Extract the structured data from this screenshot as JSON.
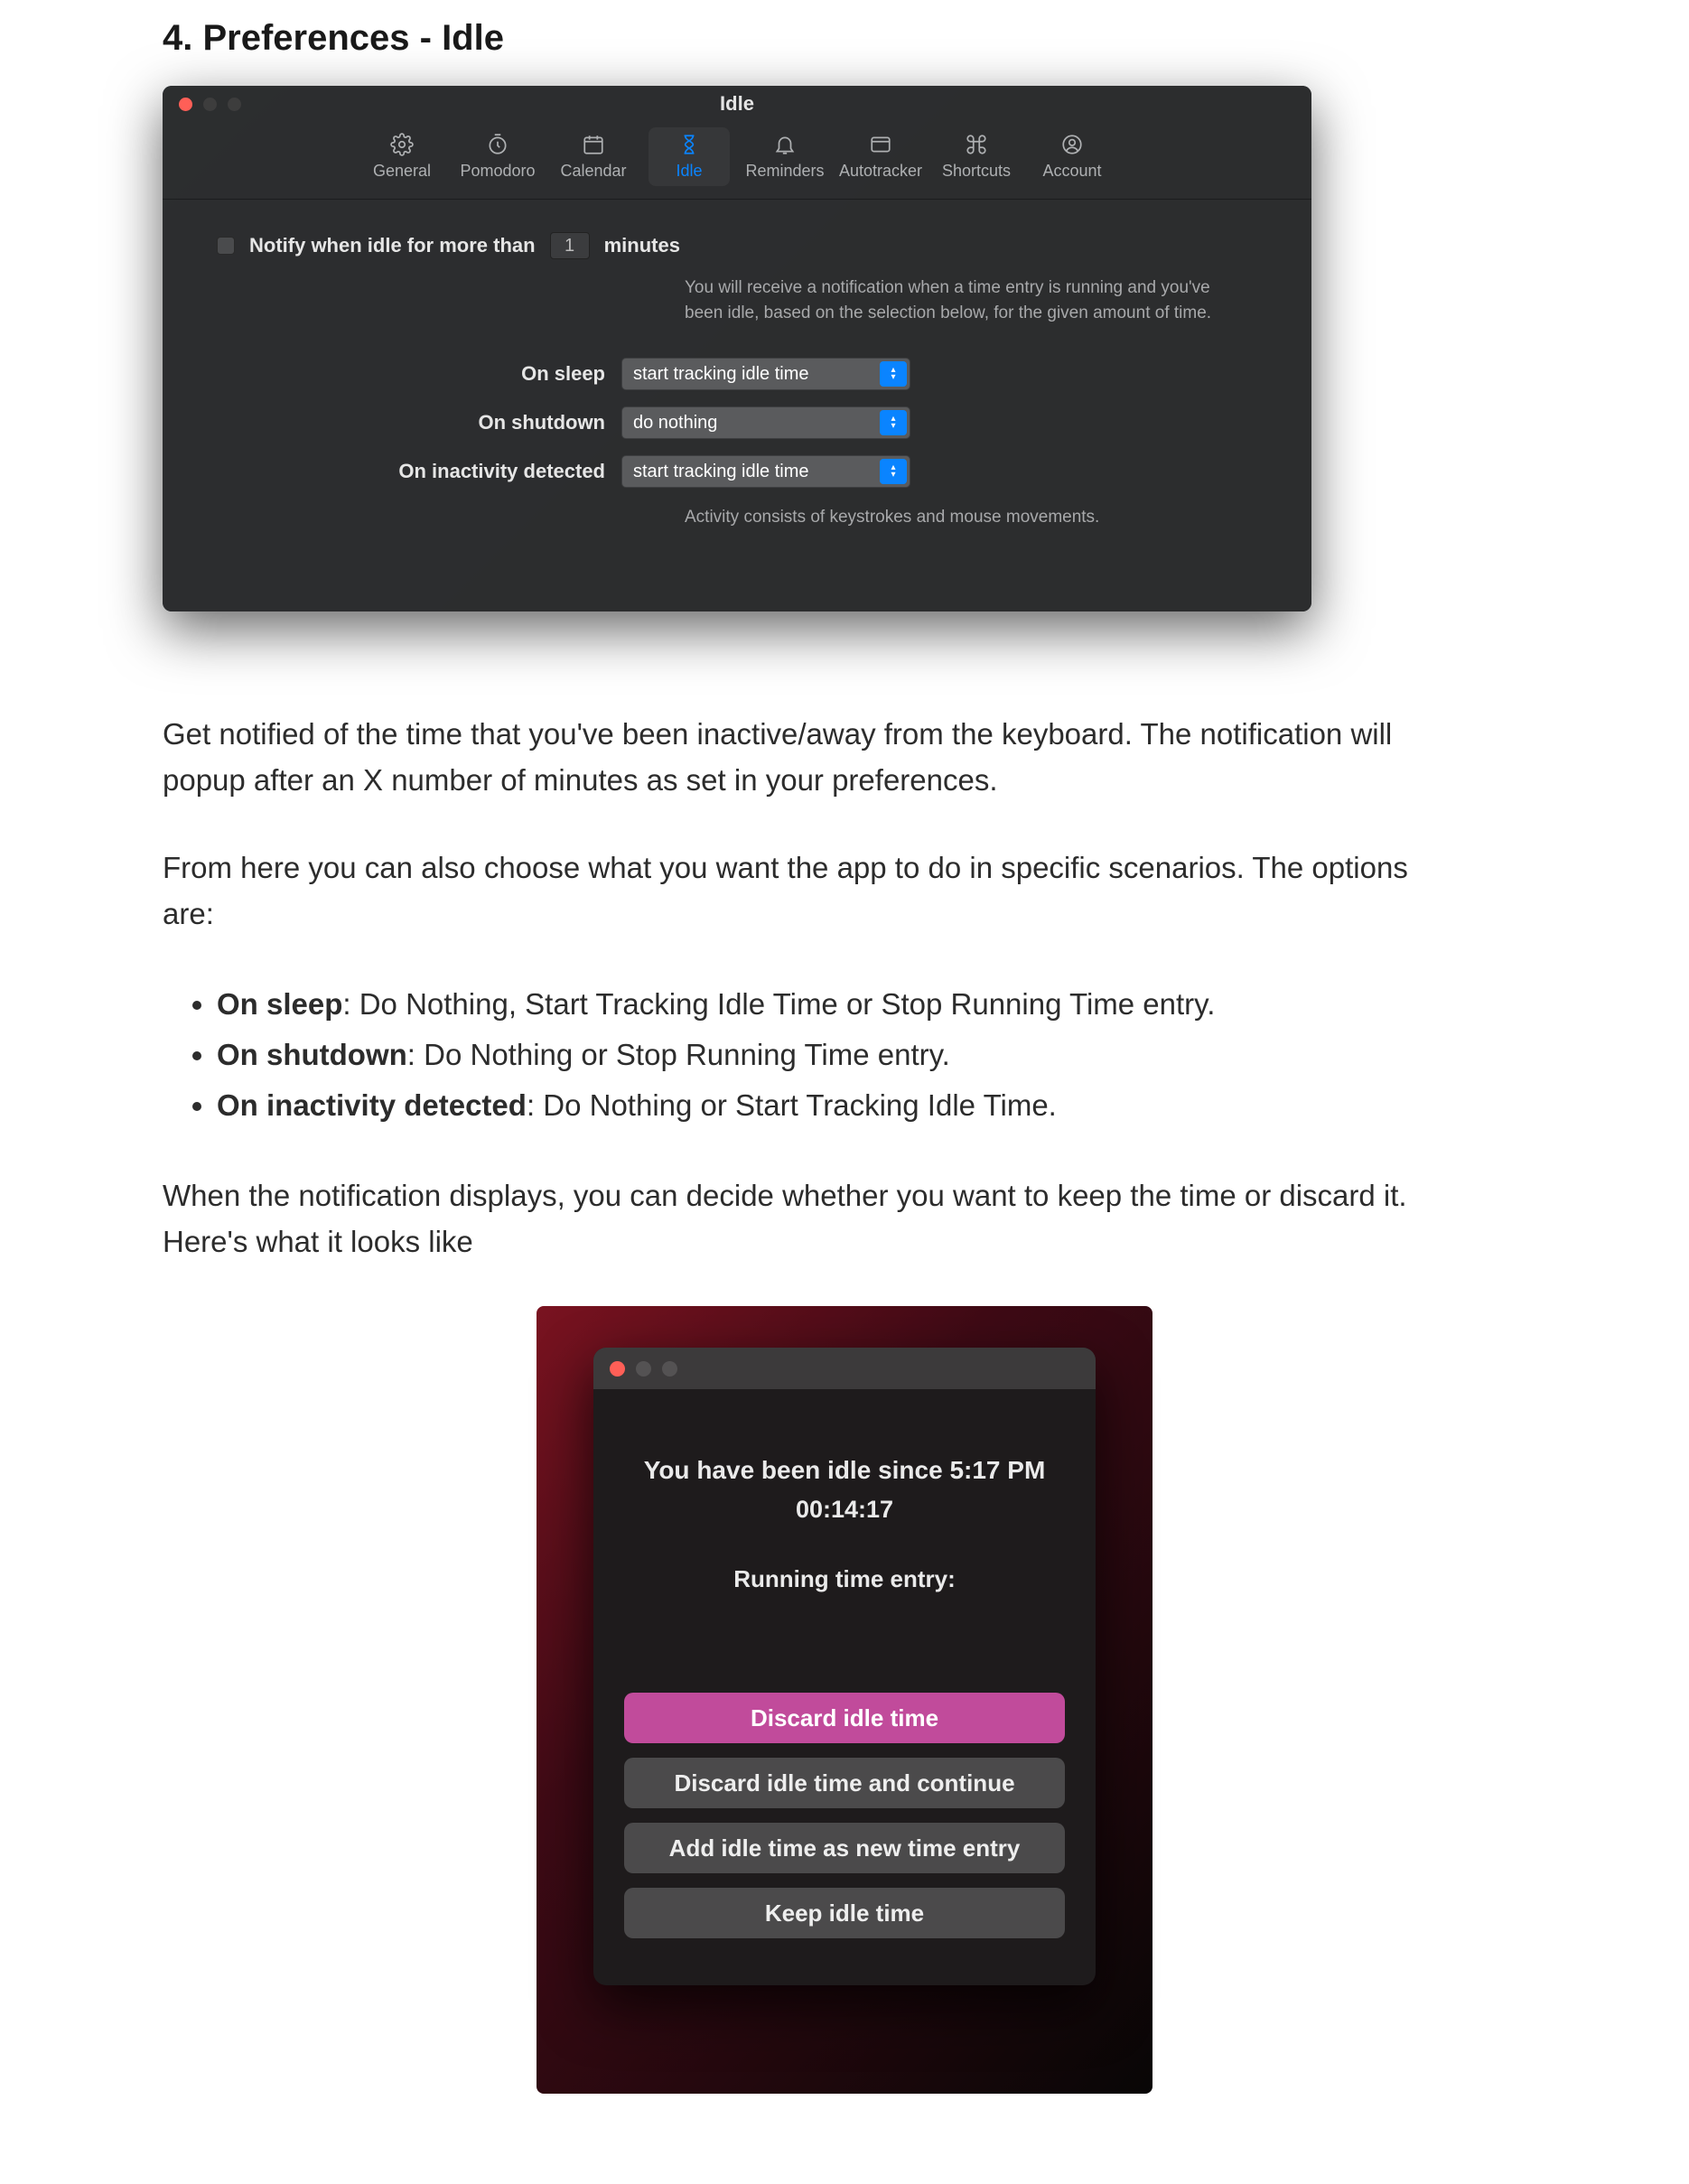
{
  "heading": "4. Preferences - Idle",
  "prefs": {
    "title": "Idle",
    "tabs": [
      {
        "label": "General"
      },
      {
        "label": "Pomodoro"
      },
      {
        "label": "Calendar"
      },
      {
        "label": "Idle"
      },
      {
        "label": "Reminders"
      },
      {
        "label": "Autotracker"
      },
      {
        "label": "Shortcuts"
      },
      {
        "label": "Account"
      }
    ],
    "notify_prefix": "Notify when idle for more than",
    "notify_value": "1",
    "notify_suffix": "minutes",
    "help": "You will receive a notification when a time entry is running and you've been idle, based on the selection below, for the given amount of time.",
    "rows": {
      "sleep_label": "On sleep",
      "sleep_value": "start tracking idle time",
      "shutdown_label": "On shutdown",
      "shutdown_value": "do nothing",
      "inactivity_label": "On inactivity detected",
      "inactivity_value": "start tracking idle time"
    },
    "activity_note": "Activity consists of keystrokes and mouse movements."
  },
  "para1": "Get notified of the time that you've been inactive/away from the keyboard. The notification will popup after an X number of minutes as set in your preferences.",
  "para2": "From here you can also choose what you want the app to do in specific scenarios. The options are:",
  "bullets": {
    "b1_strong": "On sleep",
    "b1_rest": ": Do Nothing, Start Tracking Idle Time or Stop Running Time entry.",
    "b2_strong": "On shutdown",
    "b2_rest": ": Do Nothing or Stop Running Time entry.",
    "b3_strong": "On inactivity detected",
    "b3_rest": ": Do Nothing or Start Tracking Idle Time."
  },
  "para3": "When the notification displays, you can decide whether you want to keep the time or discard it. Here's what it looks like",
  "popup": {
    "idle_since": "You have been idle since 5:17 PM",
    "duration": "00:14:17",
    "running": "Running time entry:",
    "discard": "Discard idle time",
    "discard_continue": "Discard idle time and continue",
    "add_new": "Add idle time as new time entry",
    "keep": "Keep idle time"
  }
}
